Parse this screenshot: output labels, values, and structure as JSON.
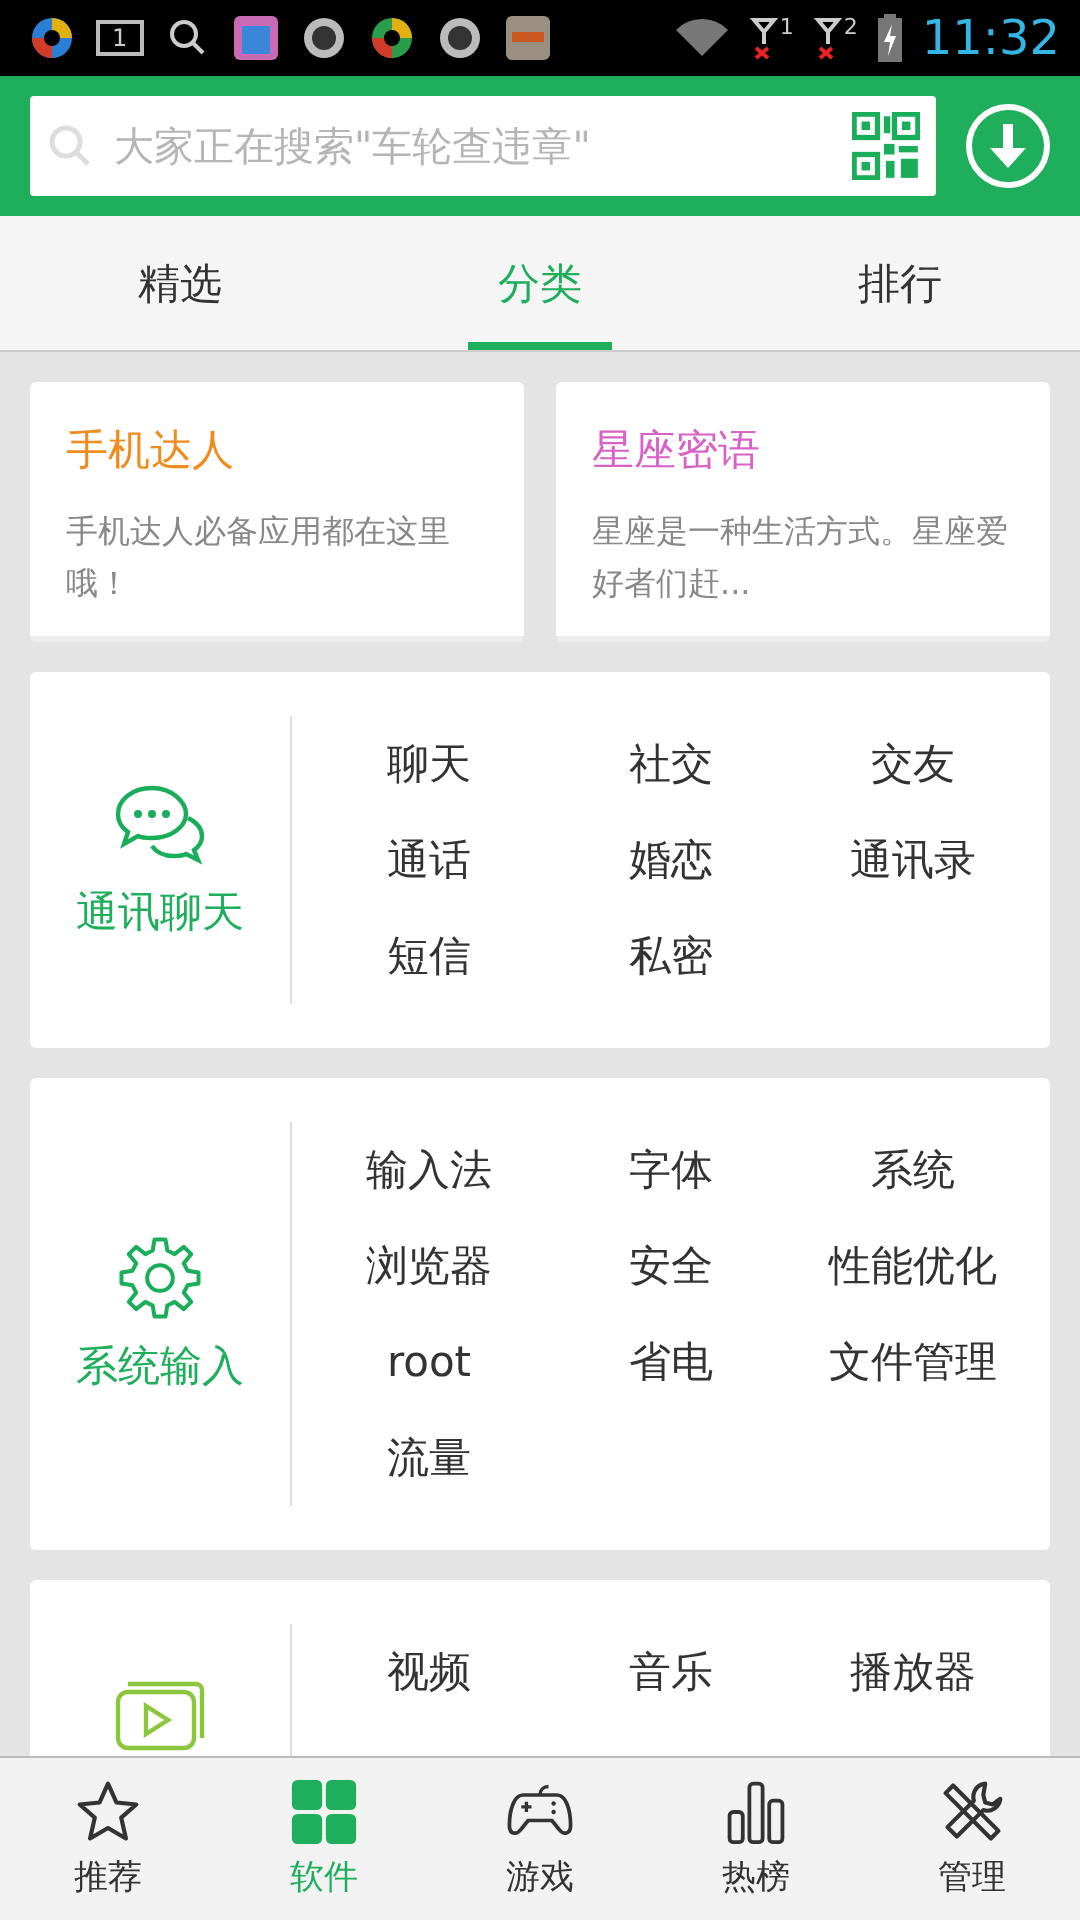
{
  "status_bar": {
    "notification_count": "1",
    "sim_slots": [
      "1",
      "2"
    ],
    "time": "11:32"
  },
  "search": {
    "placeholder": "大家正在搜索\"车轮查违章\""
  },
  "tabs": [
    {
      "label": "精选",
      "selected": false
    },
    {
      "label": "分类",
      "selected": true
    },
    {
      "label": "排行",
      "selected": false
    }
  ],
  "featured": [
    {
      "title": "手机达人",
      "description": "手机达人必备应用都在这里哦！",
      "color": "#f08c1e"
    },
    {
      "title": "星座密语",
      "description": "星座是一种生活方式。星座爱好者们赶...",
      "color": "#d862c6"
    }
  ],
  "categories": [
    {
      "kind": "chat",
      "label": "通讯聊天",
      "items": [
        "聊天",
        "社交",
        "交友",
        "通话",
        "婚恋",
        "通讯录",
        "短信",
        "私密"
      ]
    },
    {
      "kind": "gear",
      "label": "系统输入",
      "items": [
        "输入法",
        "字体",
        "系统",
        "浏览器",
        "安全",
        "性能优化",
        "root",
        "省电",
        "文件管理",
        "流量"
      ]
    },
    {
      "kind": "video",
      "items": [
        "视频",
        "音乐",
        "播放器"
      ]
    }
  ],
  "bottom_nav": [
    {
      "kind": "star",
      "label": "推荐",
      "selected": false
    },
    {
      "kind": "grid",
      "label": "软件",
      "selected": true
    },
    {
      "kind": "gamepad",
      "label": "游戏",
      "selected": false
    },
    {
      "kind": "bars",
      "label": "热榜",
      "selected": false
    },
    {
      "kind": "tools",
      "label": "管理",
      "selected": false
    }
  ]
}
